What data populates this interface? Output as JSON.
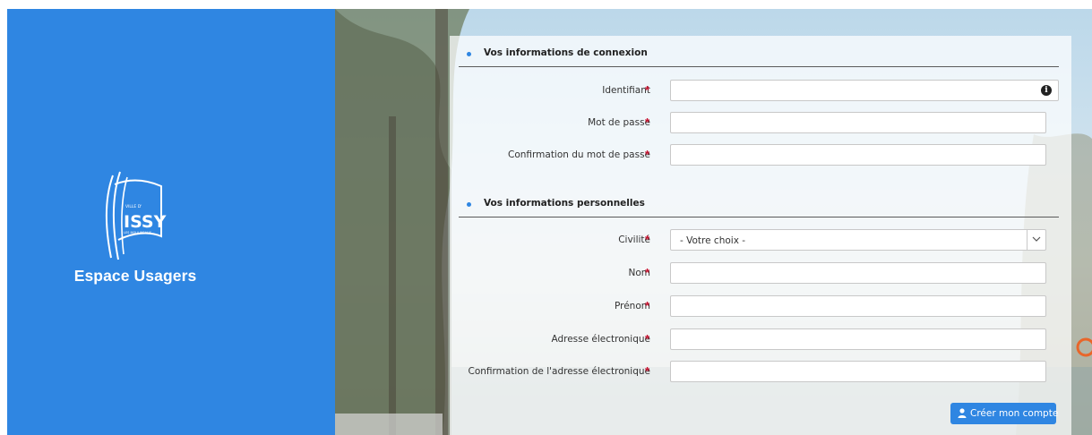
{
  "sidebar": {
    "brand": "Espace Usagers",
    "logo": {
      "text": "ISSY",
      "top_text": "VILLE D'",
      "bottom_text": "LES MOULINEAUX",
      "icon": "issy-logo-icon"
    },
    "color": "#2f86e2"
  },
  "login_section": {
    "title": "Vos informations de connexion",
    "fields": [
      {
        "label": "Identifiant",
        "required": "*",
        "value": "",
        "icon": "info-icon"
      },
      {
        "label": "Mot de passe",
        "required": "*",
        "value": ""
      },
      {
        "label": "Confirmation du mot de passe",
        "required": "*",
        "value": ""
      }
    ]
  },
  "personal_section": {
    "title": "Vos informations personnelles",
    "civility": {
      "label": "Civilité",
      "required": "*",
      "selected": "- Votre choix -"
    },
    "fields": [
      {
        "label": "Nom",
        "required": "*",
        "value": ""
      },
      {
        "label": "Prénom",
        "required": "*",
        "value": ""
      },
      {
        "label": "Adresse électronique",
        "required": "*",
        "value": ""
      },
      {
        "label": "Confirmation de l'adresse électronique",
        "required": "*",
        "value": ""
      }
    ]
  },
  "submit": {
    "label": "Créer mon compte",
    "icon": "user-icon"
  },
  "colors": {
    "accent": "#2f86e2",
    "required": "#c8102e"
  }
}
